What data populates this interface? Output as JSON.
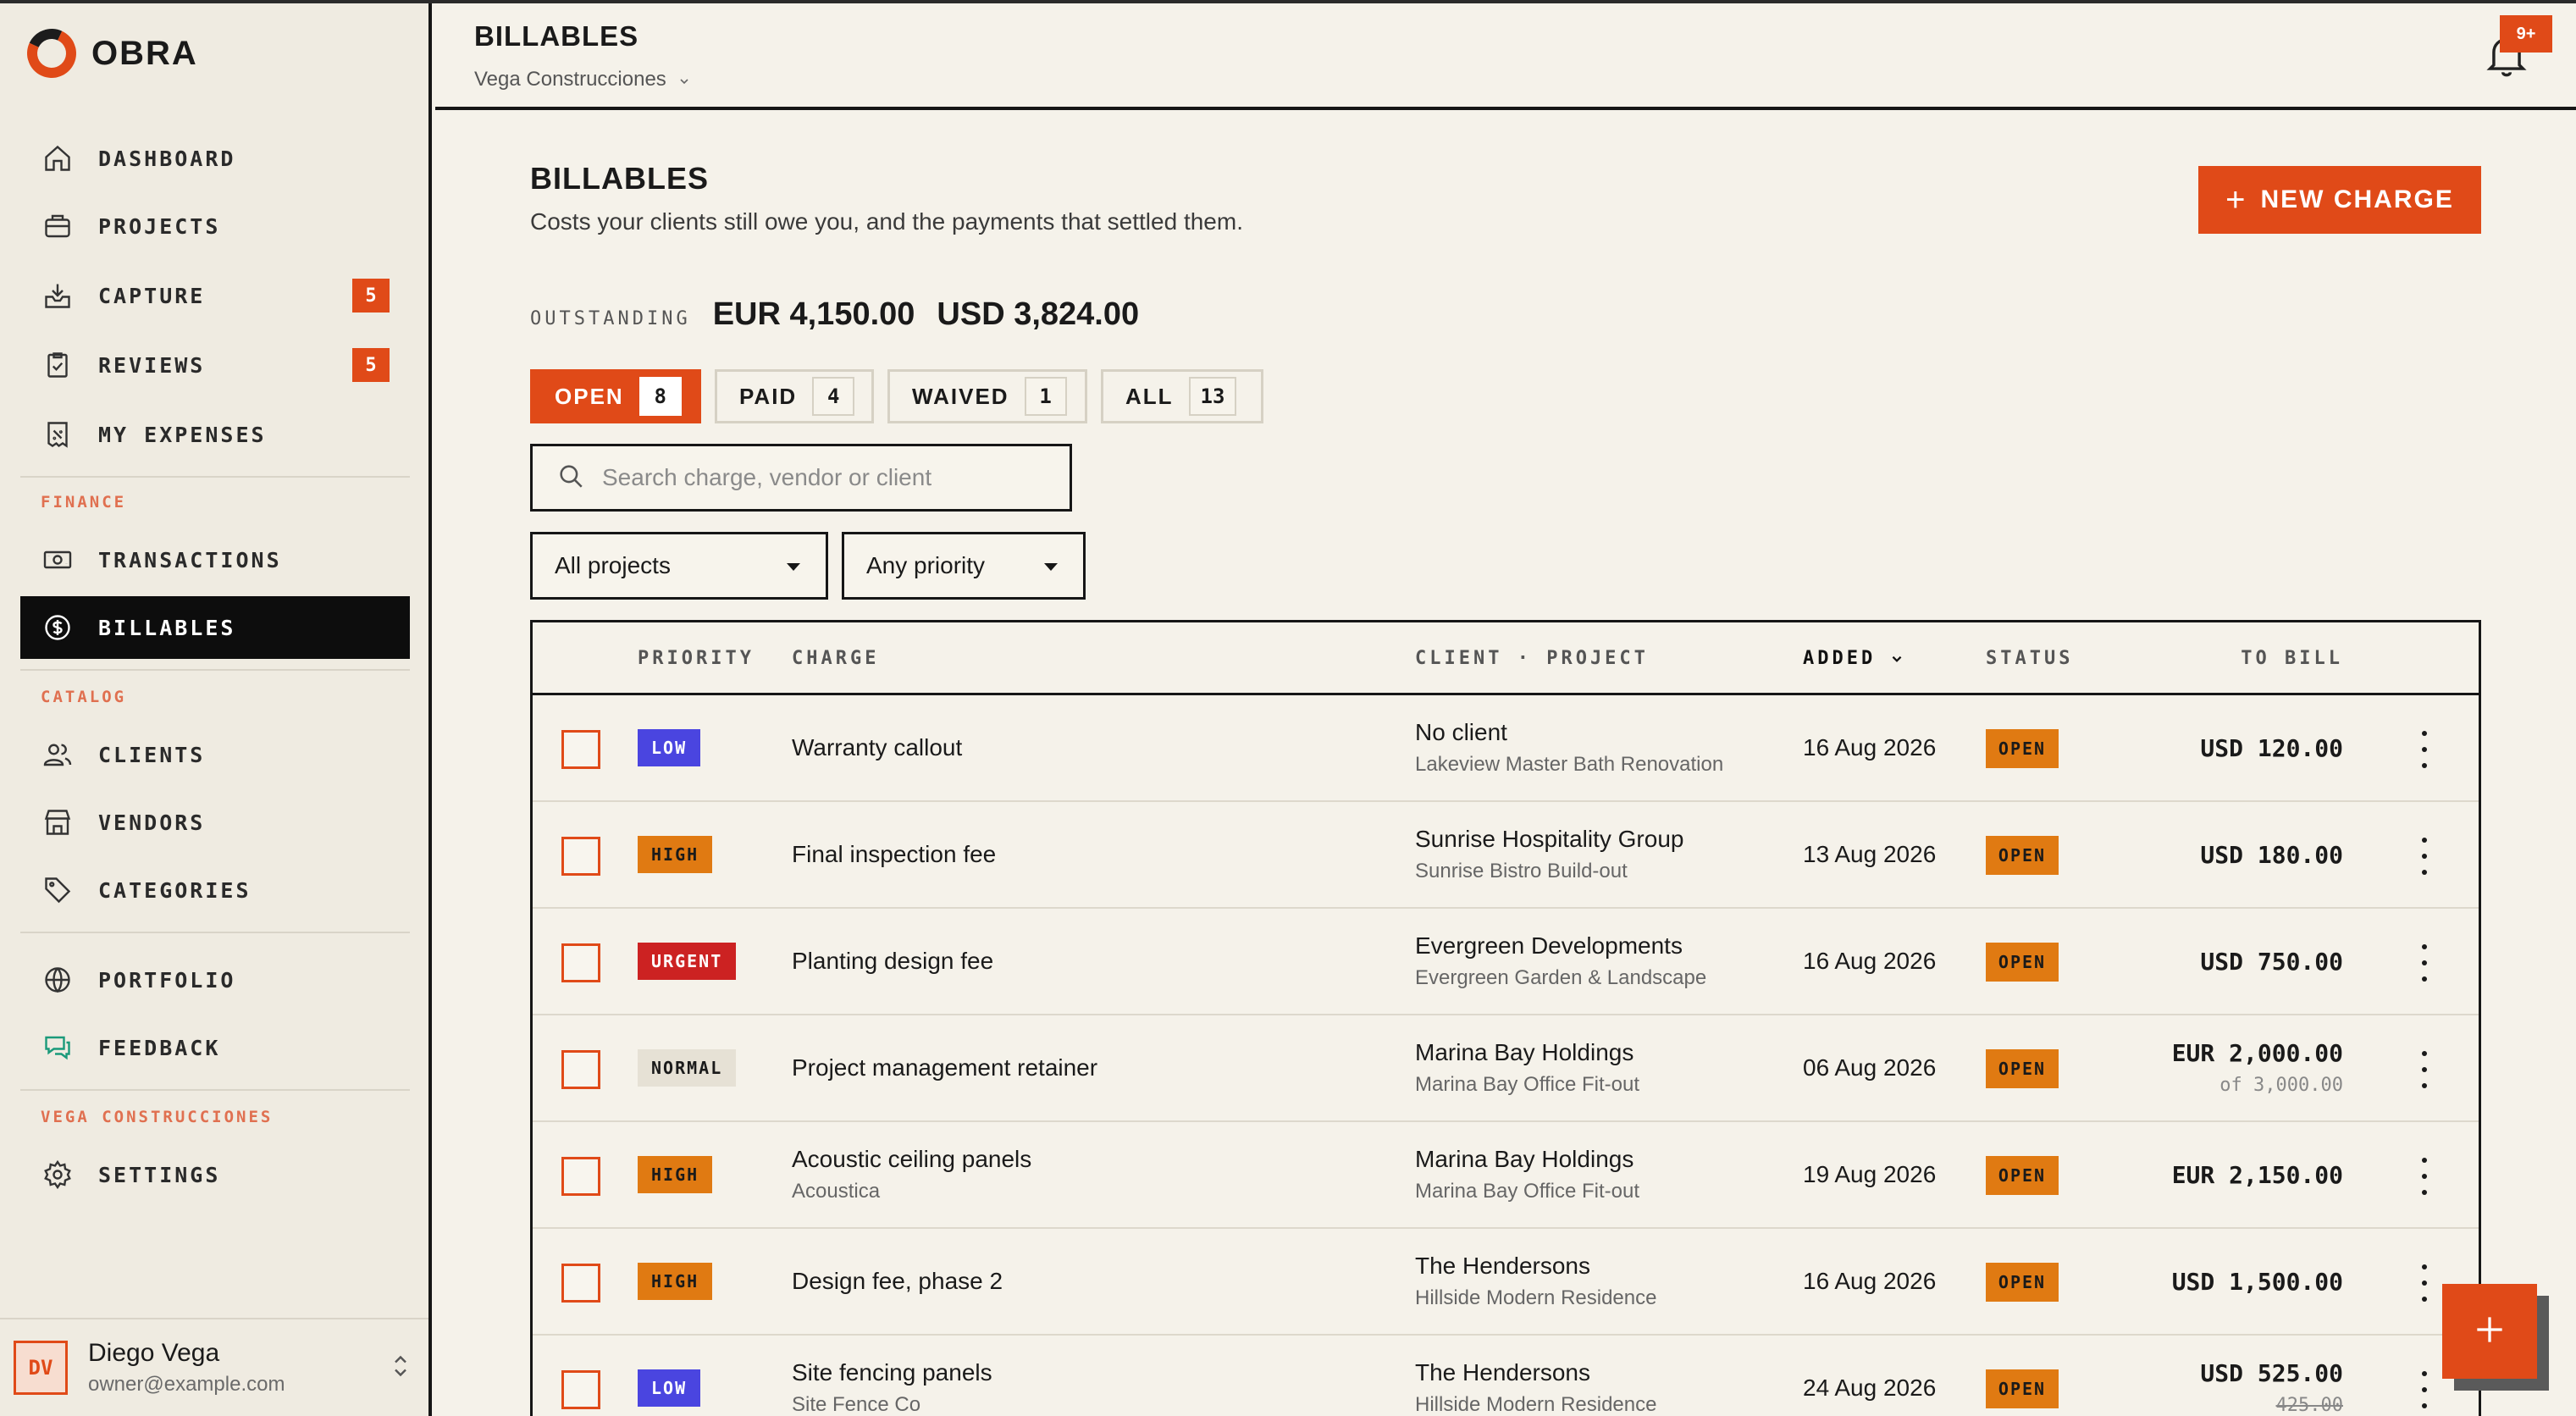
{
  "app": {
    "name": "OBRA"
  },
  "sidebar": {
    "main_items": [
      {
        "label": "DASHBOARD",
        "icon": "home-icon"
      },
      {
        "label": "PROJECTS",
        "icon": "briefcase-icon"
      },
      {
        "label": "CAPTURE",
        "icon": "inbox-icon",
        "badge": "5"
      },
      {
        "label": "REVIEWS",
        "icon": "clipboard-check-icon",
        "badge": "5"
      },
      {
        "label": "MY EXPENSES",
        "icon": "receipt-icon"
      }
    ],
    "finance_label": "FINANCE",
    "finance_items": [
      {
        "label": "TRANSACTIONS",
        "icon": "banknote-icon"
      },
      {
        "label": "BILLABLES",
        "icon": "dollar-circle-icon",
        "active": true
      }
    ],
    "catalog_label": "CATALOG",
    "catalog_items": [
      {
        "label": "CLIENTS",
        "icon": "users-icon"
      },
      {
        "label": "VENDORS",
        "icon": "store-icon"
      },
      {
        "label": "CATEGORIES",
        "icon": "tag-icon"
      }
    ],
    "other_items": [
      {
        "label": "PORTFOLIO",
        "icon": "globe-icon"
      },
      {
        "label": "FEEDBACK",
        "icon": "chat-icon"
      }
    ],
    "org_label": "VEGA CONSTRUCCIONES",
    "org_items": [
      {
        "label": "SETTINGS",
        "icon": "gear-icon"
      }
    ],
    "user": {
      "initials": "DV",
      "name": "Diego Vega",
      "email": "owner@example.com"
    }
  },
  "topbar": {
    "title": "BILLABLES",
    "org": "Vega Construcciones",
    "notifications": "9+"
  },
  "page": {
    "title": "BILLABLES",
    "subtitle": "Costs your clients still owe you, and the payments that settled them.",
    "new_button": "NEW CHARGE",
    "outstanding_label": "OUTSTANDING",
    "outstanding": [
      "EUR 4,150.00",
      "USD 3,824.00"
    ]
  },
  "tabs": [
    {
      "label": "OPEN",
      "count": "8",
      "active": true
    },
    {
      "label": "PAID",
      "count": "4"
    },
    {
      "label": "WAIVED",
      "count": "1"
    },
    {
      "label": "ALL",
      "count": "13"
    }
  ],
  "search": {
    "placeholder": "Search charge, vendor or client"
  },
  "filters": {
    "project": "All projects",
    "priority": "Any priority"
  },
  "table": {
    "columns": {
      "priority": "PRIORITY",
      "charge": "CHARGE",
      "client_project": "CLIENT · PROJECT",
      "added": "ADDED",
      "status": "STATUS",
      "to_bill": "TO BILL"
    },
    "rows": [
      {
        "priority": "LOW",
        "charge": "Warranty callout",
        "vendor": "",
        "client": "No client",
        "project": "Lakeview Master Bath Renovation",
        "added": "16 Aug 2026",
        "status": "OPEN",
        "amount": "USD 120.00",
        "amount_sub": ""
      },
      {
        "priority": "HIGH",
        "charge": "Final inspection fee",
        "vendor": "",
        "client": "Sunrise Hospitality Group",
        "project": "Sunrise Bistro Build-out",
        "added": "13 Aug 2026",
        "status": "OPEN",
        "amount": "USD 180.00",
        "amount_sub": ""
      },
      {
        "priority": "URGENT",
        "charge": "Planting design fee",
        "vendor": "",
        "client": "Evergreen Developments",
        "project": "Evergreen Garden & Landscape",
        "added": "16 Aug 2026",
        "status": "OPEN",
        "amount": "USD 750.00",
        "amount_sub": ""
      },
      {
        "priority": "NORMAL",
        "charge": "Project management retainer",
        "vendor": "",
        "client": "Marina Bay Holdings",
        "project": "Marina Bay Office Fit-out",
        "added": "06 Aug 2026",
        "status": "OPEN",
        "amount": "EUR 2,000.00",
        "amount_sub": "of 3,000.00"
      },
      {
        "priority": "HIGH",
        "charge": "Acoustic ceiling panels",
        "vendor": "Acoustica",
        "client": "Marina Bay Holdings",
        "project": "Marina Bay Office Fit-out",
        "added": "19 Aug 2026",
        "status": "OPEN",
        "amount": "EUR 2,150.00",
        "amount_sub": ""
      },
      {
        "priority": "HIGH",
        "charge": "Design fee, phase 2",
        "vendor": "",
        "client": "The Hendersons",
        "project": "Hillside Modern Residence",
        "added": "16 Aug 2026",
        "status": "OPEN",
        "amount": "USD 1,500.00",
        "amount_sub": ""
      },
      {
        "priority": "LOW",
        "charge": "Site fencing panels",
        "vendor": "Site Fence Co",
        "client": "The Hendersons",
        "project": "Hillside Modern Residence",
        "added": "24 Aug 2026",
        "status": "OPEN",
        "amount": "USD 525.00",
        "amount_sub": "425.00"
      }
    ]
  },
  "colors": {
    "accent": "#e04a18",
    "priority_low": "#4a45e0",
    "priority_high": "#e07a12",
    "priority_urgent": "#cc2222",
    "priority_normal": "#e6e1d5",
    "status_open": "#e07a12"
  }
}
